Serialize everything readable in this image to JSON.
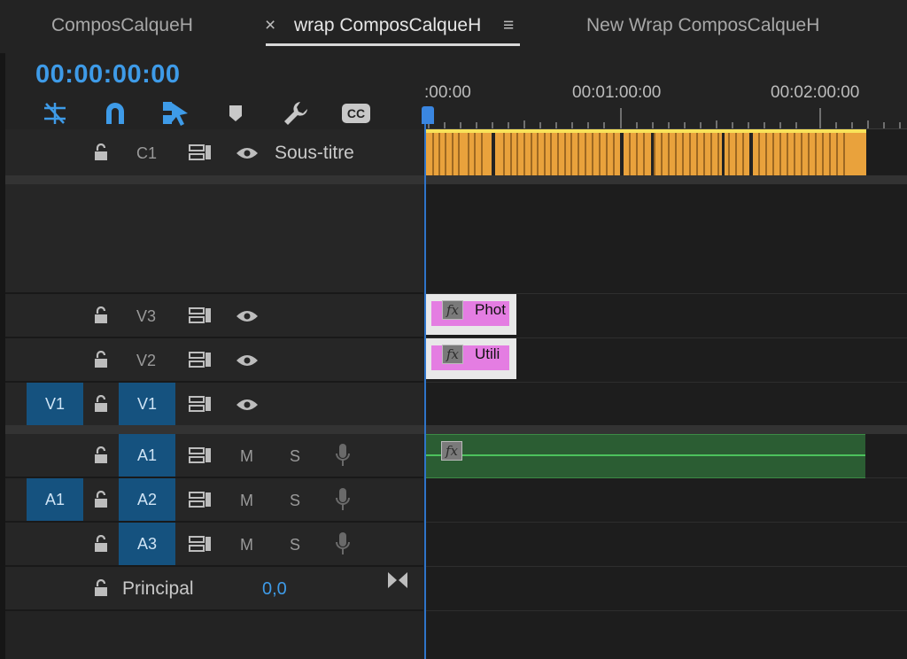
{
  "tabs": [
    {
      "label": "ComposCalqueH",
      "active": false
    },
    {
      "label": "wrap ComposCalqueH",
      "active": true,
      "close_glyph": "×",
      "menu_glyph": "≡"
    },
    {
      "label": "New Wrap ComposCalqueH",
      "active": false
    }
  ],
  "timecode": "00:00:00:00",
  "toolbar": {
    "icons": [
      "nest-sequence-icon",
      "snap-magnet-icon",
      "linked-selection-icon",
      "add-marker-icon",
      "timeline-settings-wrench-icon",
      "captions-cc-icon"
    ],
    "cc_label": "CC"
  },
  "ruler": {
    "labels": [
      ":00:00",
      "00:01:00:00",
      "00:02:00:00"
    ]
  },
  "tracks": {
    "caption": {
      "name": "C1",
      "title": "Sous-titre"
    },
    "video": [
      {
        "name": "V3",
        "source_target": ""
      },
      {
        "name": "V2",
        "source_target": ""
      },
      {
        "name": "V1",
        "source_target": "V1"
      }
    ],
    "audio": [
      {
        "name": "A1",
        "source_target": "",
        "mute": "M",
        "solo": "S"
      },
      {
        "name": "A2",
        "source_target": "A1",
        "mute": "M",
        "solo": "S"
      },
      {
        "name": "A3",
        "source_target": "",
        "mute": "M",
        "solo": "S"
      }
    ],
    "master": {
      "name": "Principal",
      "value": "0,0"
    }
  },
  "clips": {
    "v3": {
      "label": "Phot",
      "fx": "fx"
    },
    "v2": {
      "label": "Utili",
      "fx": "fx"
    },
    "a1": {
      "fx": "fx"
    }
  },
  "colors": {
    "accent": "#3e9be8",
    "caption_clip": "#e9a23c",
    "graphic_clip": "#e47de2",
    "audio_clip": "#2b5d33",
    "target_blue": "#15527f"
  }
}
